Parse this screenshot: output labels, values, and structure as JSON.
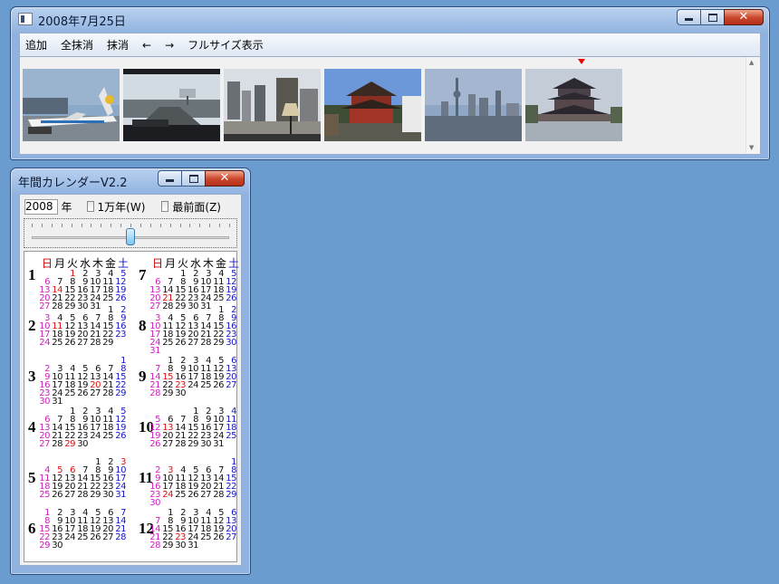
{
  "photo_window": {
    "title": "2008年7月25日",
    "menu": [
      "追加",
      "全抹消",
      "抹消",
      "←",
      "→",
      "フルサイズ表示"
    ],
    "thumbnails": [
      "airplane-photo",
      "highway-photo",
      "city-street-photo",
      "pagoda-photo",
      "skyline-photo",
      "temple-photo"
    ],
    "selected_index": 5
  },
  "calendar_window": {
    "title": "年間カレンダーV2.2",
    "year_value": "2008",
    "year_label": "年",
    "check_10000": "1万年(W)",
    "check_topmost": "最前面(Z)",
    "weekdays": [
      "日",
      "月",
      "火",
      "水",
      "木",
      "金",
      "土"
    ],
    "months": [
      {
        "num": "1",
        "start": 2,
        "days": 31,
        "holidays": [
          1,
          14
        ]
      },
      {
        "num": "2",
        "start": 5,
        "days": 29,
        "holidays": [
          11
        ]
      },
      {
        "num": "3",
        "start": 6,
        "days": 31,
        "holidays": [
          20
        ]
      },
      {
        "num": "4",
        "start": 2,
        "days": 30,
        "holidays": [
          29
        ]
      },
      {
        "num": "5",
        "start": 4,
        "days": 31,
        "holidays": [
          3,
          4,
          5,
          6
        ]
      },
      {
        "num": "6",
        "start": 0,
        "days": 30,
        "holidays": []
      },
      {
        "num": "7",
        "start": 2,
        "days": 31,
        "holidays": [
          21
        ]
      },
      {
        "num": "8",
        "start": 5,
        "days": 31,
        "holidays": []
      },
      {
        "num": "9",
        "start": 1,
        "days": 30,
        "holidays": [
          15,
          23
        ]
      },
      {
        "num": "10",
        "start": 3,
        "days": 31,
        "holidays": [
          13
        ]
      },
      {
        "num": "11",
        "start": 6,
        "days": 30,
        "holidays": [
          3,
          24
        ]
      },
      {
        "num": "12",
        "start": 1,
        "days": 31,
        "holidays": [
          23
        ]
      }
    ]
  },
  "colors": {
    "sunday": "#d020c0",
    "saturday": "#1515c8",
    "holiday": "#e01010",
    "desktop": "#6a9cd0"
  }
}
